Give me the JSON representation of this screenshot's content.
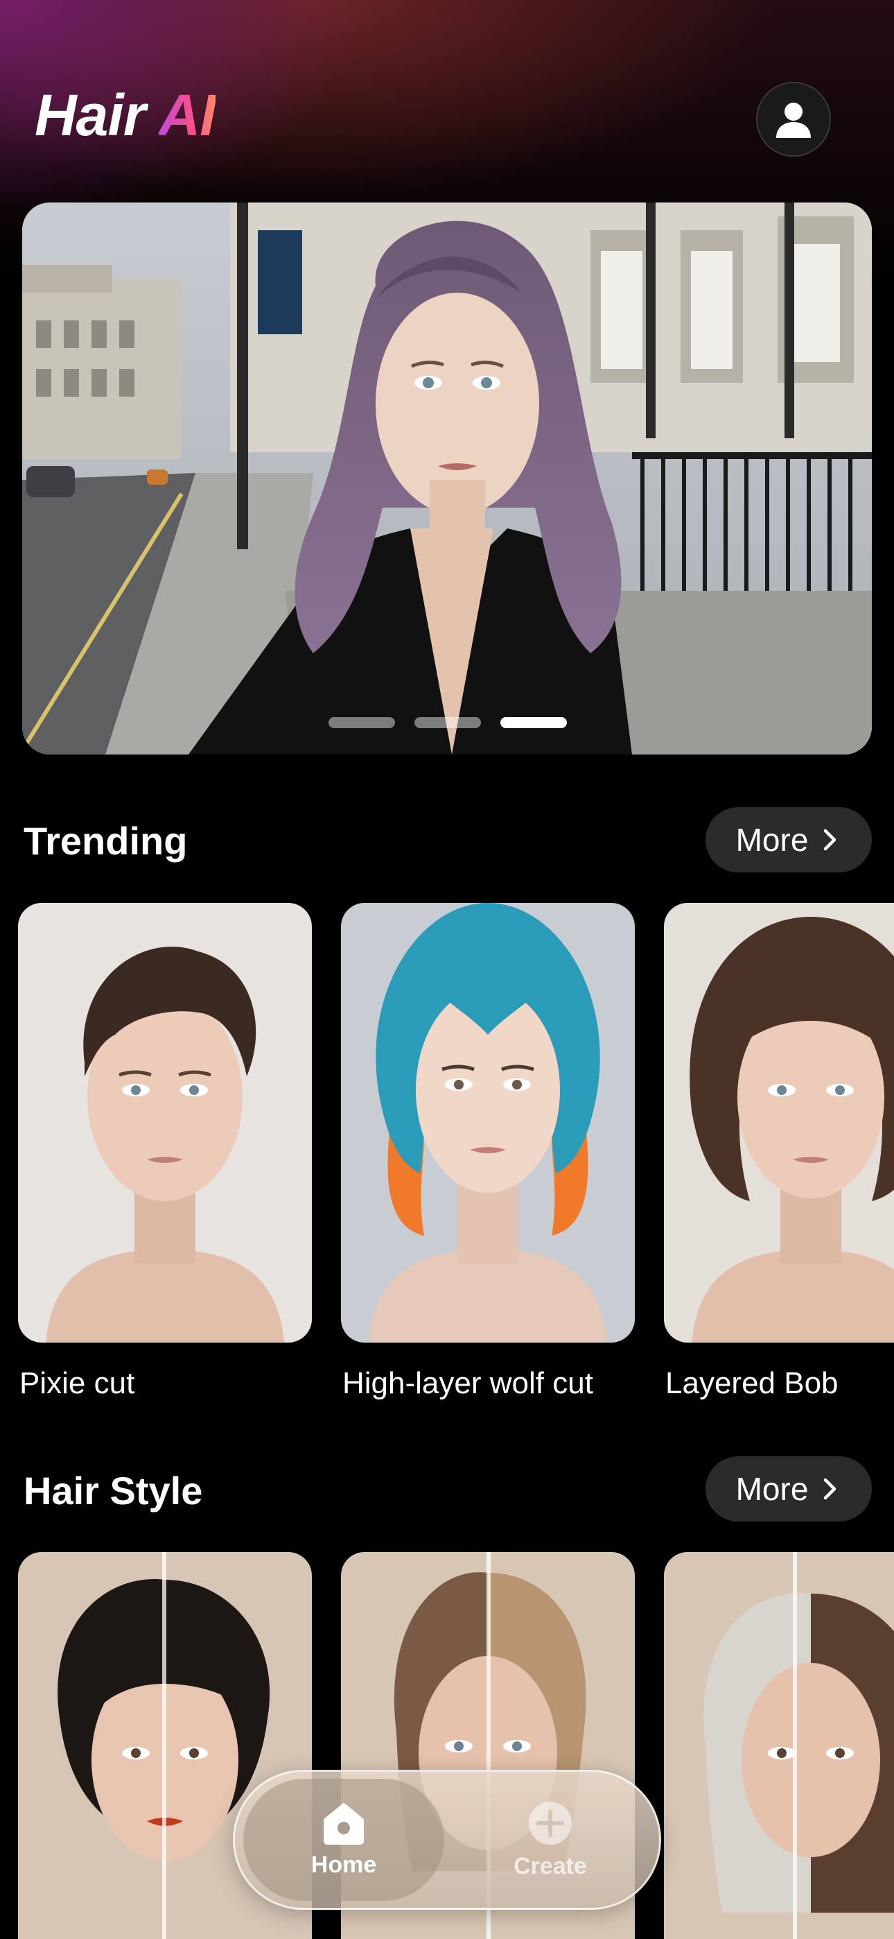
{
  "app": {
    "logo_main": "Hair ",
    "logo_accent": "AI"
  },
  "hero": {
    "slide_count": 3,
    "active_slide": 3
  },
  "trending": {
    "title": "Trending",
    "more_label": "More",
    "items": [
      {
        "label": "Pixie cut"
      },
      {
        "label": "High-layer wolf cut"
      },
      {
        "label": "Layered Bob"
      }
    ]
  },
  "hair_style": {
    "title": "Hair Style",
    "more_label": "More"
  },
  "tabbar": {
    "home_label": "Home",
    "create_label": "Create"
  },
  "icons": {
    "profile": "person-icon",
    "more": "chevron-right-icon",
    "home": "home-icon",
    "create": "plus-circle-icon"
  }
}
